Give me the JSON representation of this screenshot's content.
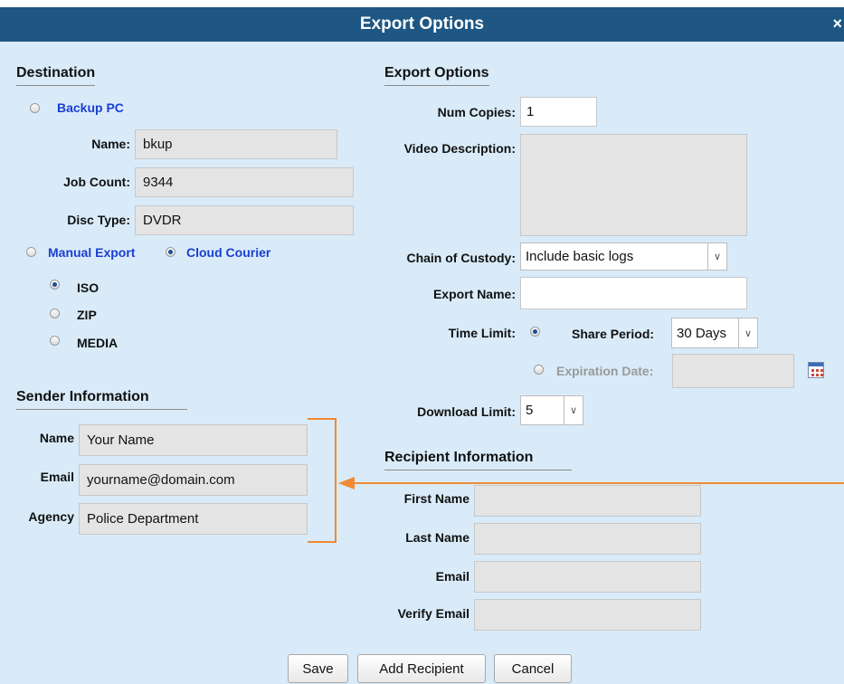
{
  "dialog": {
    "title": "Export Options",
    "close_glyph": "×"
  },
  "destination": {
    "heading": "Destination",
    "backup_pc_label": "Backup PC",
    "name_label": "Name:",
    "name_value": "bkup",
    "job_count_label": "Job Count:",
    "job_count_value": "9344",
    "disc_type_label": "Disc Type:",
    "disc_type_value": "DVDR",
    "manual_export_label": "Manual Export",
    "cloud_courier_label": "Cloud Courier",
    "cloud_courier_selected": true,
    "formats": [
      {
        "label": "ISO",
        "selected": true
      },
      {
        "label": "ZIP",
        "selected": false
      },
      {
        "label": "MEDIA",
        "selected": false
      }
    ]
  },
  "export_options": {
    "heading": "Export Options",
    "num_copies_label": "Num Copies:",
    "num_copies_value": "1",
    "video_description_label": "Video Description:",
    "video_description_value": "",
    "chain_of_custody_label": "Chain of Custody:",
    "chain_of_custody_value": "Include basic logs",
    "export_name_label": "Export Name:",
    "export_name_value": "",
    "time_limit_label": "Time Limit:",
    "share_period_label": "Share Period:",
    "share_period_value": "30 Days",
    "expiration_date_label": "Expiration Date:",
    "expiration_date_value": "",
    "download_limit_label": "Download Limit:",
    "download_limit_value": "5"
  },
  "sender": {
    "heading": "Sender Information",
    "name_label": "Name",
    "name_value": "Your Name",
    "email_label": "Email",
    "email_value": "yourname@domain.com",
    "agency_label": "Agency",
    "agency_value": "Police Department"
  },
  "recipient": {
    "heading": "Recipient Information",
    "first_name_label": "First Name",
    "first_name_value": "",
    "last_name_label": "Last Name",
    "last_name_value": "",
    "email_label": "Email",
    "email_value": "",
    "verify_email_label": "Verify Email",
    "verify_email_value": ""
  },
  "buttons": {
    "save": "Save",
    "add_recipient": "Add Recipient",
    "cancel": "Cancel"
  },
  "icons": {
    "dropdown": "chevron-down-icon",
    "calendar": "calendar-icon",
    "close": "close-icon"
  },
  "colors": {
    "titlebar": "#1e5783",
    "background": "#d9ebf9",
    "annotation": "#f08a32",
    "link": "#1a3fd1"
  }
}
